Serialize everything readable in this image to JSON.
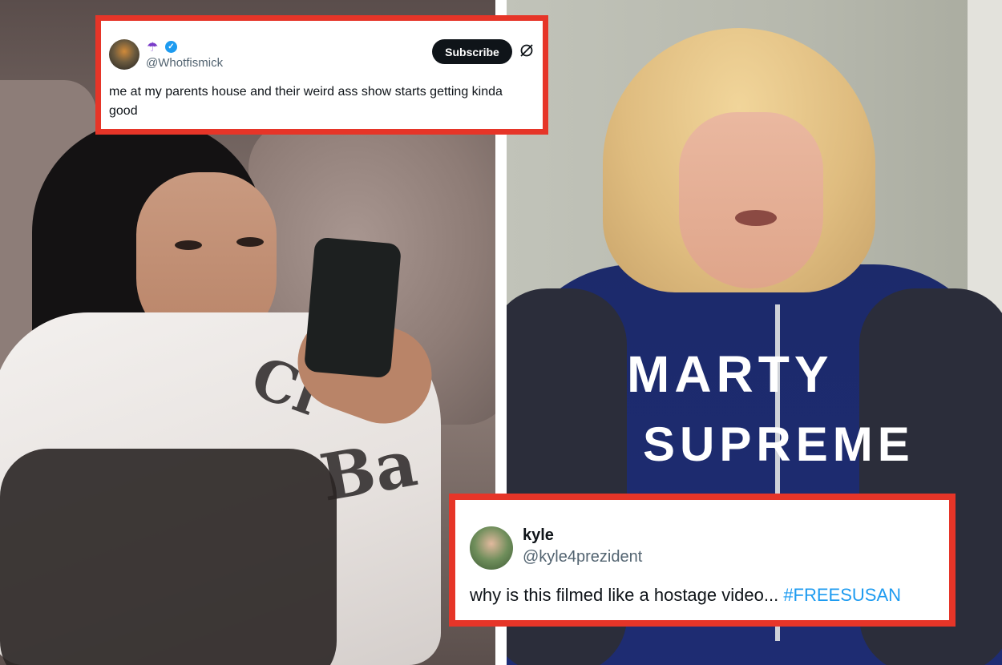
{
  "tweets": [
    {
      "name_emoji": "☂",
      "handle": "@Whotfismick",
      "subscribe_label": "Subscribe",
      "text": "me at my parents house and their weird ass show starts getting kinda good"
    },
    {
      "name": "kyle",
      "handle": "@kyle4prezident",
      "text": "why is this filmed like a hostage video...",
      "hashtag": "#FREESUSAN"
    }
  ],
  "photo_right": {
    "jacket_line1": "MARTY",
    "jacket_line2": "SUPREME"
  },
  "photo_left": {
    "hoodie_fragment1": "Cl",
    "hoodie_fragment2": "Ba"
  },
  "colors": {
    "frame": "#e63528",
    "verified": "#1d9bf0",
    "hashtag": "#1d9bf0"
  }
}
